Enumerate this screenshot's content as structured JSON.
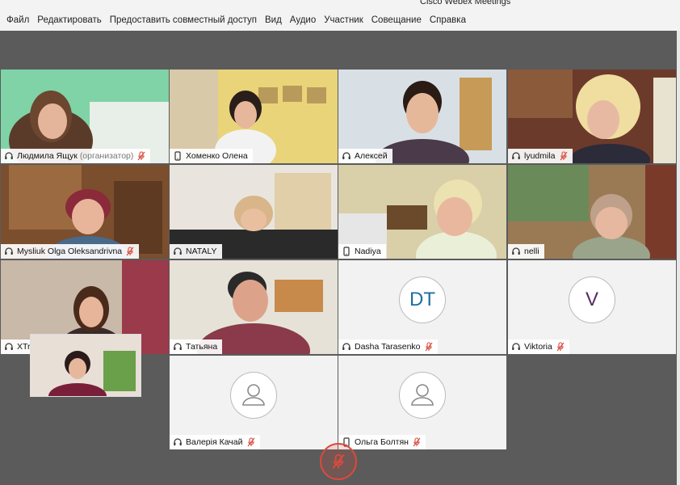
{
  "window": {
    "title": "Cisco Webex Meetings"
  },
  "menu": [
    "Файл",
    "Редактировать",
    "Предоставить совместный доступ",
    "Вид",
    "Аудио",
    "Участник",
    "Совещание",
    "Справка"
  ],
  "participants": [
    {
      "name": "Людмила Ящук",
      "role": "(организатор)",
      "device": "headset-icon",
      "muted": true
    },
    {
      "name": "Хоменко Олена",
      "device": "phone-icon",
      "muted": false
    },
    {
      "name": "Алексей",
      "device": "headset-call-icon",
      "muted": false
    },
    {
      "name": "lyudmila",
      "device": "headset-icon",
      "muted": true
    },
    {
      "name": "Mysliuk Olga Oleksandrivna",
      "device": "headset-icon",
      "muted": true
    },
    {
      "name": "NATALY",
      "device": "headset-icon",
      "muted": false
    },
    {
      "name": "Nadiya",
      "device": "phone-icon",
      "muted": false
    },
    {
      "name": "nelli",
      "device": "headset-icon",
      "muted": false
    },
    {
      "name": "XTreme.ws",
      "device": "headset-icon",
      "muted": false
    },
    {
      "name": "Татьяна",
      "device": "headset-icon",
      "muted": false
    },
    {
      "name": "Dasha Tarasenko",
      "device": "headset-icon",
      "muted": true,
      "initials": "DT"
    },
    {
      "name": "Viktoria",
      "device": "headset-icon",
      "muted": true,
      "initials": "V"
    },
    {
      "name": "Валерія Качай",
      "device": "headset-icon",
      "muted": true
    },
    {
      "name": "Ольга  Болтян",
      "device": "phone-icon",
      "muted": true
    }
  ],
  "colors": {
    "accent": "#3fb6e3",
    "mute": "#d94b3d",
    "stage": "#5b5b5b"
  }
}
